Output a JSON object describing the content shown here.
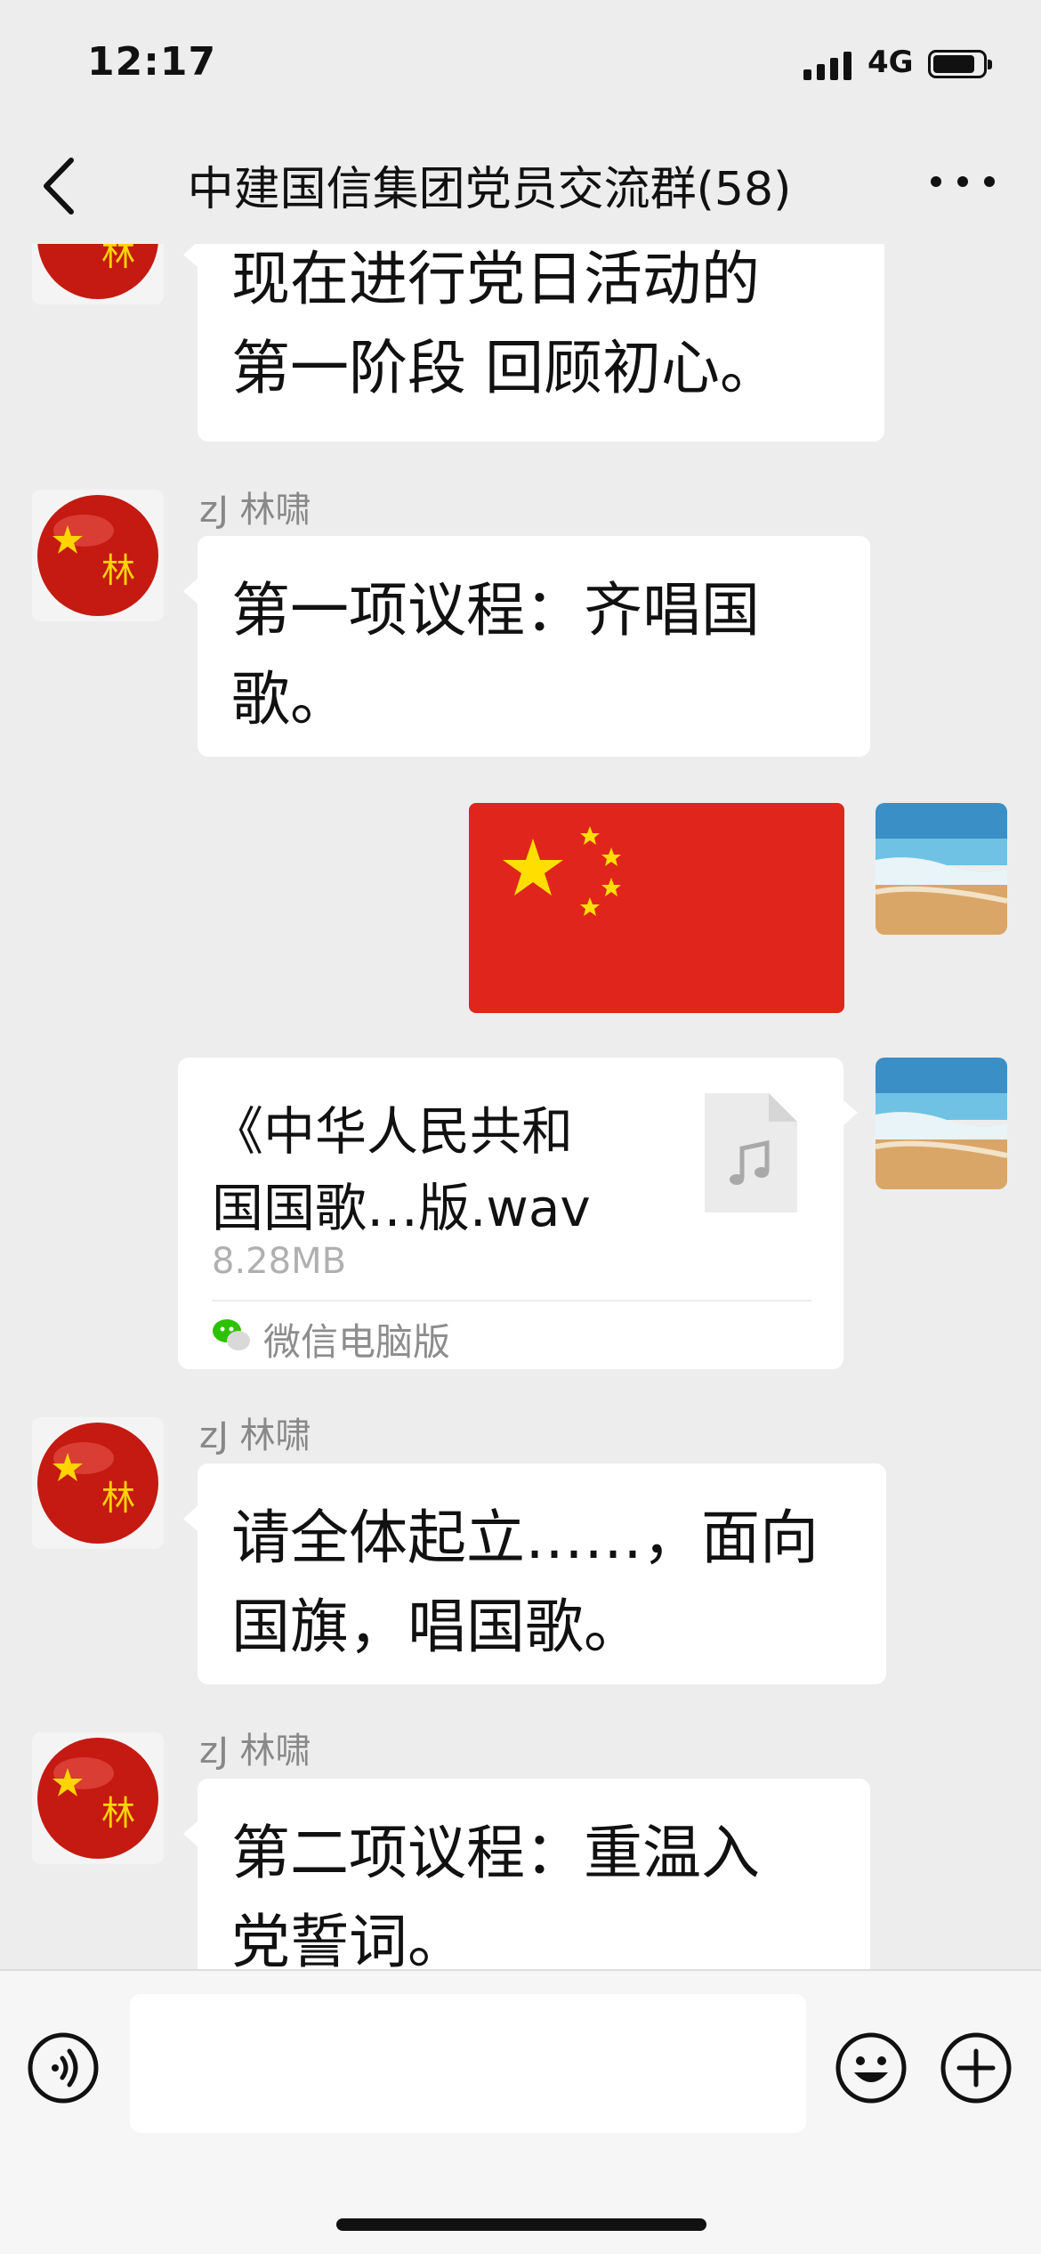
{
  "status_bar": {
    "time": "12:17",
    "network": "4G"
  },
  "nav": {
    "title": "中建国信集团党员交流群(58)",
    "back_icon": "chevron-left-icon",
    "more_icon": "ellipsis-icon"
  },
  "messages": [
    {
      "type": "text",
      "side": "left",
      "sender": "",
      "lines": [
        "现在进行党日活动的",
        "第一阶段  回顾初心。"
      ]
    },
    {
      "type": "text",
      "side": "left",
      "sender": "zJ 林啸",
      "lines": [
        "第一项议程：齐唱国",
        "歌。"
      ]
    },
    {
      "type": "image",
      "side": "right",
      "description_icon": "china-flag-image"
    },
    {
      "type": "file",
      "side": "right",
      "file_name_lines": [
        "《中华人民共和",
        "国国歌…版.wav"
      ],
      "file_size": "8.28MB",
      "source": "微信电脑版"
    },
    {
      "type": "text",
      "side": "left",
      "sender": "zJ 林啸",
      "lines": [
        "请全体起立……，面向",
        "国旗，唱国歌。"
      ]
    },
    {
      "type": "text",
      "side": "left",
      "sender": "zJ 林啸",
      "lines": [
        "第二项议程：重温入",
        "党誓词。"
      ]
    }
  ],
  "colors": {
    "background": "#ededed",
    "bubble": "#ffffff",
    "flag_red": "#e0261c",
    "flag_star": "#ffde00"
  }
}
